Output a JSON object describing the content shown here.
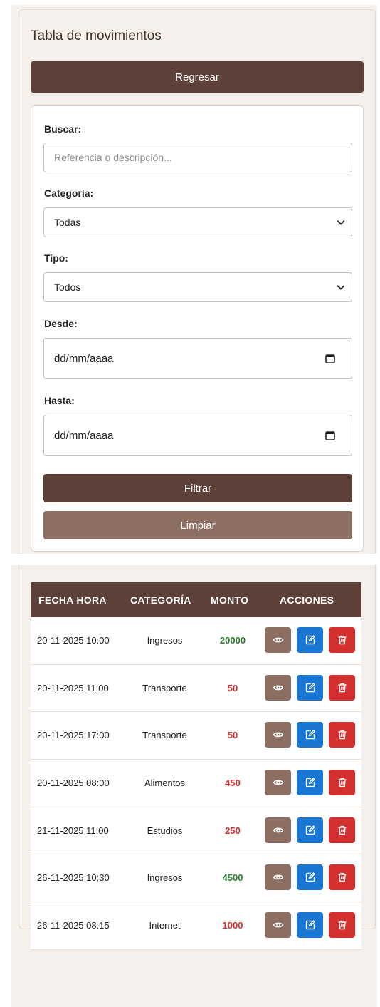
{
  "page": {
    "title": "Tabla de movimientos",
    "back_label": "Regresar"
  },
  "filters": {
    "search_label": "Buscar:",
    "search_placeholder": "Referencia o descripción...",
    "category_label": "Categoría:",
    "category_value": "Todas",
    "type_label": "Tipo:",
    "type_value": "Todos",
    "from_label": "Desde:",
    "from_value": "dd/mm/aaaa",
    "to_label": "Hasta:",
    "to_value": "dd/mm/aaaa",
    "filter_label": "Filtrar",
    "clear_label": "Limpiar"
  },
  "table": {
    "headers": [
      "FECHA HORA",
      "CATEGORÍA",
      "MONTO",
      "ACCIONES"
    ],
    "rows": [
      {
        "date": "20-11-2025 10:00",
        "category": "Ingresos",
        "amount": "20000",
        "kind": "income"
      },
      {
        "date": "20-11-2025 11:00",
        "category": "Transporte",
        "amount": "50",
        "kind": "expense"
      },
      {
        "date": "20-11-2025 17:00",
        "category": "Transporte",
        "amount": "50",
        "kind": "expense"
      },
      {
        "date": "20-11-2025 08:00",
        "category": "Alimentos",
        "amount": "450",
        "kind": "expense"
      },
      {
        "date": "21-11-2025 11:00",
        "category": "Estudios",
        "amount": "250",
        "kind": "expense"
      },
      {
        "date": "26-11-2025 10:30",
        "category": "Ingresos",
        "amount": "4500",
        "kind": "income"
      },
      {
        "date": "26-11-2025 08:15",
        "category": "Internet",
        "amount": "1000",
        "kind": "expense"
      }
    ]
  },
  "colors": {
    "primary": "#5d4037",
    "secondary": "#8d6e63",
    "edit": "#1976d2",
    "delete": "#d32f2f",
    "income": "#2e7d32",
    "expense": "#d32f2f"
  },
  "icons": {
    "view": "eye-icon",
    "edit": "edit-icon",
    "delete": "trash-icon"
  }
}
